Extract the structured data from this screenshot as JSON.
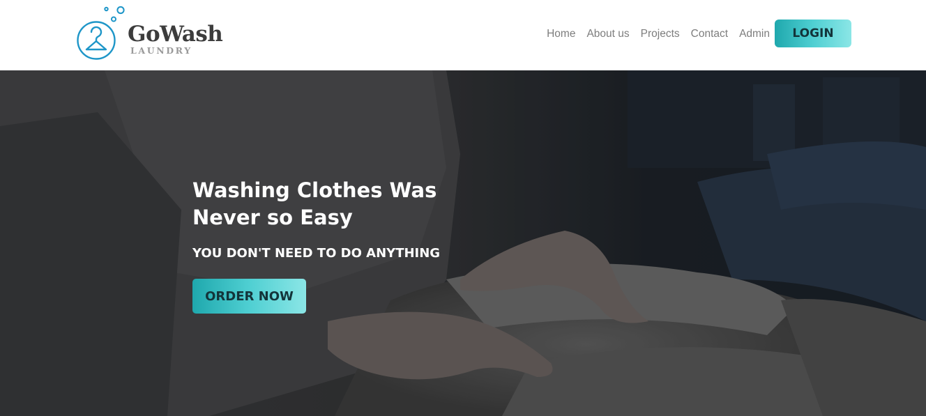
{
  "brand": {
    "name": "GoWash",
    "subtitle": "LAUNDRY",
    "logo_icon": "hanger-icon",
    "accent_color": "#1e96c8"
  },
  "nav": {
    "links": [
      "Home",
      "About us",
      "Projects",
      "Contact",
      "Admin"
    ],
    "login_label": "LOGIN"
  },
  "hero": {
    "title": "Washing Clothes Was Never so Easy",
    "subtitle": "YOU DON'T NEED TO DO ANYTHING",
    "cta_label": "ORDER NOW",
    "background": "dark photo of hands folding towels"
  },
  "colors": {
    "button_gradient_start": "#1fa8ad",
    "button_gradient_end": "#8be6e6",
    "nav_text": "#7d7d7d",
    "hero_text": "#ffffff"
  }
}
